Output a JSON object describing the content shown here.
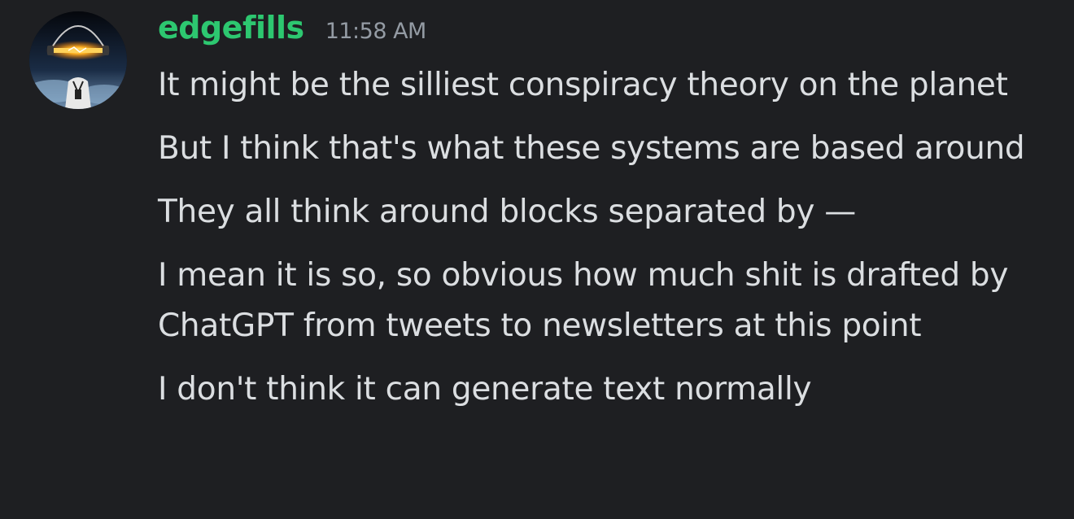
{
  "author": {
    "username": "edgefills",
    "timestamp": "11:58 AM",
    "username_color": "#2dc770"
  },
  "avatar": {
    "icon": "glowing-light-bar-avatar-icon"
  },
  "messages": [
    "It might be the silliest conspiracy theory on the planet",
    "But I think that's what these systems are based around",
    "They all think around blocks separated by —",
    "I mean it is so, so obvious how much shit is drafted by ChatGPT from tweets to newsletters at this point",
    "I don't think it can generate text normally"
  ],
  "colors": {
    "background": "#1e1f22",
    "text": "#dbdee1",
    "timestamp": "#949ba4"
  }
}
